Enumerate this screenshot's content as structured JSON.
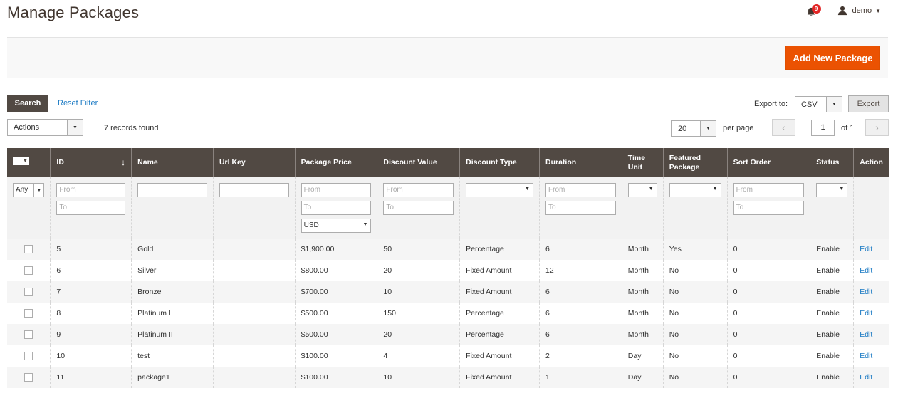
{
  "page_title": "Manage Packages",
  "header": {
    "notification_count": "9",
    "user_name": "demo"
  },
  "toolbar": {
    "add_button": "Add New Package",
    "search_button": "Search",
    "reset_filter": "Reset Filter",
    "export_label": "Export to:",
    "export_format": "CSV",
    "export_button": "Export",
    "actions_label": "Actions",
    "records_found": "7 records found",
    "per_page_value": "20",
    "per_page_label": "per page",
    "current_page": "1",
    "page_of": "of 1"
  },
  "columns": [
    "ID",
    "Name",
    "Url Key",
    "Package Price",
    "Discount Value",
    "Discount Type",
    "Duration",
    "Time Unit",
    "Featured Package",
    "Sort Order",
    "Status",
    "Action"
  ],
  "filters": {
    "any": "Any",
    "from": "From",
    "to": "To",
    "currency": "USD"
  },
  "rows": [
    {
      "id": "5",
      "name": "Gold",
      "url_key": "",
      "price": "$1,900.00",
      "discount_value": "50",
      "discount_type": "Percentage",
      "duration": "6",
      "time_unit": "Month",
      "featured": "Yes",
      "sort_order": "0",
      "status": "Enable",
      "action": "Edit"
    },
    {
      "id": "6",
      "name": "Silver",
      "url_key": "",
      "price": "$800.00",
      "discount_value": "20",
      "discount_type": "Fixed Amount",
      "duration": "12",
      "time_unit": "Month",
      "featured": "No",
      "sort_order": "0",
      "status": "Enable",
      "action": "Edit"
    },
    {
      "id": "7",
      "name": "Bronze",
      "url_key": "",
      "price": "$700.00",
      "discount_value": "10",
      "discount_type": "Fixed Amount",
      "duration": "6",
      "time_unit": "Month",
      "featured": "No",
      "sort_order": "0",
      "status": "Enable",
      "action": "Edit"
    },
    {
      "id": "8",
      "name": "Platinum I",
      "url_key": "",
      "price": "$500.00",
      "discount_value": "150",
      "discount_type": "Percentage",
      "duration": "6",
      "time_unit": "Month",
      "featured": "No",
      "sort_order": "0",
      "status": "Enable",
      "action": "Edit"
    },
    {
      "id": "9",
      "name": "Platinum II",
      "url_key": "",
      "price": "$500.00",
      "discount_value": "20",
      "discount_type": "Percentage",
      "duration": "6",
      "time_unit": "Month",
      "featured": "No",
      "sort_order": "0",
      "status": "Enable",
      "action": "Edit"
    },
    {
      "id": "10",
      "name": "test",
      "url_key": "",
      "price": "$100.00",
      "discount_value": "4",
      "discount_type": "Fixed Amount",
      "duration": "2",
      "time_unit": "Day",
      "featured": "No",
      "sort_order": "0",
      "status": "Enable",
      "action": "Edit"
    },
    {
      "id": "11",
      "name": "package1",
      "url_key": "",
      "price": "$100.00",
      "discount_value": "10",
      "discount_type": "Fixed Amount",
      "duration": "1",
      "time_unit": "Day",
      "featured": "No",
      "sort_order": "0",
      "status": "Enable",
      "action": "Edit"
    }
  ]
}
